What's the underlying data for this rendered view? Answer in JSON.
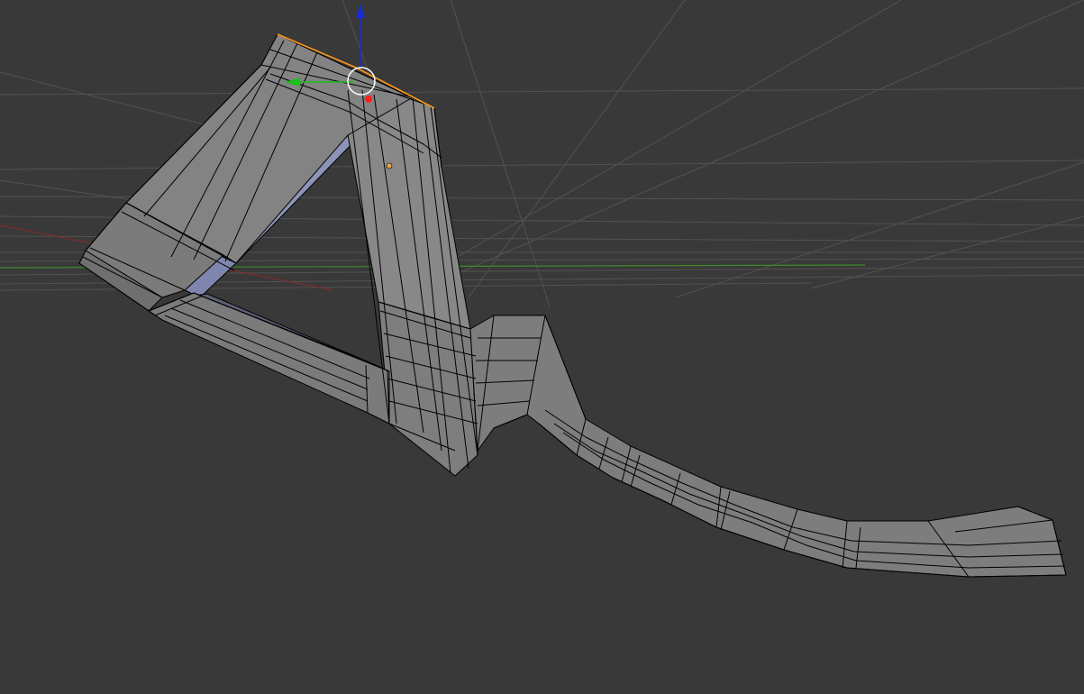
{
  "viewport": {
    "background": "#393939",
    "grid_color": "#555555",
    "axis_x_color": "#8a2b2b",
    "axis_y_color": "#3a8a2a"
  },
  "mesh": {
    "face_light": "#858585",
    "face_mid": "#7a7a7a",
    "face_dark": "#6a6a6a",
    "face_inner": "#8d93b8",
    "wire": "#000000",
    "selected_edge": "#ff9a1a"
  },
  "gizmo": {
    "z_axis_color": "#1b2bd8",
    "y_axis_color": "#19c019",
    "pivot_color": "#ff1f1f",
    "origin_color": "#e3a64a",
    "ring_color": "#ffffff"
  }
}
